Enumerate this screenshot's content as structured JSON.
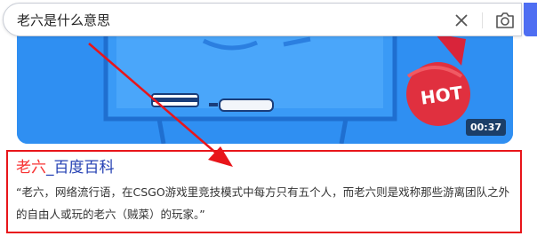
{
  "search": {
    "query": "老六是什么意思"
  },
  "video": {
    "duration": "00:37",
    "badge": "HOT"
  },
  "result": {
    "title_highlight": "老六",
    "title_rest": "_百度百科",
    "snippet": "“老六，网络流行语，在CSGO游戏里竞技模式中每方只有五个人，而老六则是戏称那些游离团队之外的自由人或玩的老六（贼菜）的玩家。”"
  },
  "icons": {
    "clear": "close-icon",
    "camera": "camera-icon"
  },
  "colors": {
    "accent": "#4e6ef2",
    "annotation": "#e8151a",
    "title_link": "#2440b3",
    "title_highlight": "#f73131",
    "video_bg": "#2f8ff2"
  }
}
